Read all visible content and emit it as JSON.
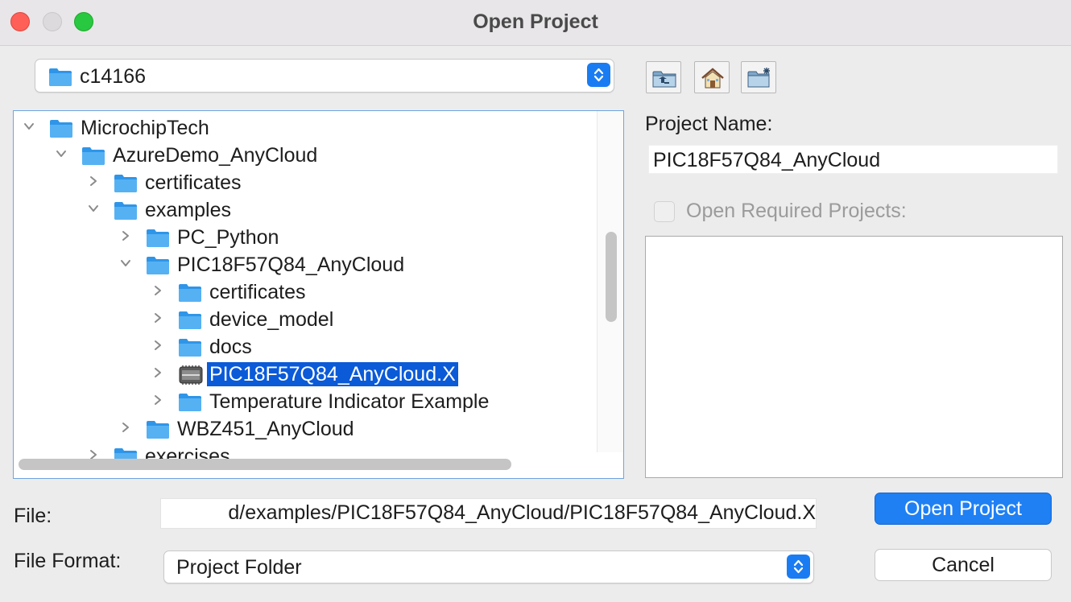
{
  "window": {
    "title": "Open Project"
  },
  "location_combo": {
    "value": "c14166"
  },
  "toolbar": {
    "up_icon": "folder-up-icon",
    "home_icon": "home-icon",
    "new_folder_icon": "new-folder-icon"
  },
  "tree": {
    "rows": [
      {
        "label": "MicrochipTech",
        "expanded": true,
        "level": 0,
        "icon": "folder-icon"
      },
      {
        "label": "AzureDemo_AnyCloud",
        "expanded": true,
        "level": 1,
        "icon": "folder-icon"
      },
      {
        "label": "certificates",
        "expanded": false,
        "level": 2,
        "icon": "folder-icon"
      },
      {
        "label": "examples",
        "expanded": true,
        "level": 2,
        "icon": "folder-icon"
      },
      {
        "label": "PC_Python",
        "expanded": false,
        "level": 3,
        "icon": "folder-icon"
      },
      {
        "label": "PIC18F57Q84_AnyCloud",
        "expanded": true,
        "level": 3,
        "icon": "folder-icon"
      },
      {
        "label": "certificates",
        "expanded": false,
        "level": 4,
        "icon": "folder-icon"
      },
      {
        "label": "device_model",
        "expanded": false,
        "level": 4,
        "icon": "folder-icon"
      },
      {
        "label": "docs",
        "expanded": false,
        "level": 4,
        "icon": "folder-icon"
      },
      {
        "label": "PIC18F57Q84_AnyCloud.X",
        "expanded": false,
        "level": 4,
        "icon": "chip-project-icon",
        "selected": true
      },
      {
        "label": "Temperature Indicator Example",
        "expanded": false,
        "level": 4,
        "icon": "folder-icon"
      },
      {
        "label": "WBZ451_AnyCloud",
        "expanded": false,
        "level": 3,
        "icon": "folder-icon"
      },
      {
        "label": "exercises",
        "expanded": false,
        "level": 2,
        "icon": "folder-icon"
      }
    ]
  },
  "project_name": {
    "label": "Project Name:",
    "value": "PIC18F57Q84_AnyCloud"
  },
  "open_required": {
    "label": "Open Required Projects:",
    "checked": false,
    "enabled": false
  },
  "file": {
    "label": "File:",
    "value": "d/examples/PIC18F57Q84_AnyCloud/PIC18F57Q84_AnyCloud.X"
  },
  "file_format": {
    "label": "File Format:",
    "value": "Project Folder"
  },
  "buttons": {
    "open": "Open Project",
    "cancel": "Cancel"
  },
  "colors": {
    "accent": "#1f80f4",
    "selection": "#0b5ad8",
    "folder": "#4ba7f0"
  }
}
